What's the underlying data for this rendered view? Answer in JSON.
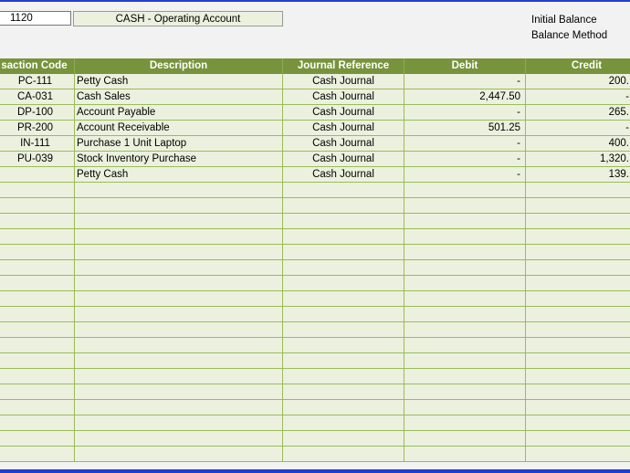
{
  "account": {
    "code": "1120",
    "name": "CASH - Operating Account"
  },
  "info": {
    "initial_balance_label": "Initial Balance",
    "balance_method_label": "Balance Method"
  },
  "table": {
    "headers": [
      "saction Code",
      "Description",
      "Journal Reference",
      "Debit",
      "Credit"
    ],
    "rows": [
      [
        "PC-111",
        "Petty Cash",
        "Cash Journal",
        "-",
        "200."
      ],
      [
        "CA-031",
        "Cash Sales",
        "Cash Journal",
        "2,447.50",
        "-"
      ],
      [
        "DP-100",
        "Account Payable",
        "Cash Journal",
        "-",
        "265."
      ],
      [
        "PR-200",
        "Account Receivable",
        "Cash Journal",
        "501.25",
        "-"
      ],
      [
        "IN-111",
        "Purchase 1 Unit Laptop",
        "Cash Journal",
        "-",
        "400."
      ],
      [
        "PU-039",
        "Stock Inventory Purchase",
        "Cash Journal",
        "-",
        "1,320."
      ],
      [
        "",
        "Petty Cash",
        "Cash Journal",
        "-",
        "139."
      ],
      [
        "",
        "",
        "",
        "",
        ""
      ],
      [
        "",
        "",
        "",
        "",
        ""
      ],
      [
        "",
        "",
        "",
        "",
        ""
      ],
      [
        "",
        "",
        "",
        "",
        ""
      ],
      [
        "",
        "",
        "",
        "",
        ""
      ],
      [
        "",
        "",
        "",
        "",
        ""
      ],
      [
        "",
        "",
        "",
        "",
        ""
      ],
      [
        "",
        "",
        "",
        "",
        ""
      ],
      [
        "",
        "",
        "",
        "",
        ""
      ],
      [
        "",
        "",
        "",
        "",
        ""
      ],
      [
        "",
        "",
        "",
        "",
        ""
      ],
      [
        "",
        "",
        "",
        "",
        ""
      ],
      [
        "",
        "",
        "",
        "",
        ""
      ],
      [
        "",
        "",
        "",
        "",
        ""
      ],
      [
        "",
        "",
        "",
        "",
        ""
      ],
      [
        "",
        "",
        "",
        "",
        ""
      ],
      [
        "",
        "",
        "",
        "",
        ""
      ],
      [
        "",
        "",
        "",
        "",
        ""
      ]
    ]
  }
}
